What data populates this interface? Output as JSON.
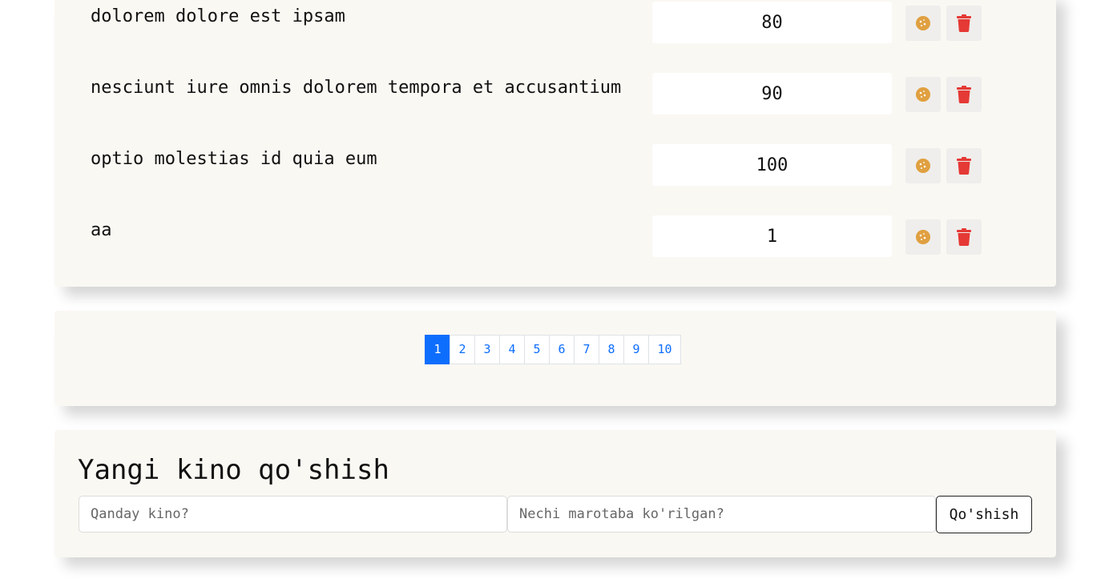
{
  "movies": [
    {
      "title": "dolorem dolore est ipsam",
      "count": "80"
    },
    {
      "title": "nesciunt iure omnis dolorem tempora et accusantium",
      "count": "90"
    },
    {
      "title": "optio molestias id quia eum",
      "count": "100"
    },
    {
      "title": "aa",
      "count": "1"
    }
  ],
  "pagination": {
    "pages": [
      "1",
      "2",
      "3",
      "4",
      "5",
      "6",
      "7",
      "8",
      "9",
      "10"
    ],
    "active_page": "1"
  },
  "form": {
    "title": "Yangi kino qo'shish",
    "name_placeholder": "Qanday kino?",
    "count_placeholder": "Nechi marotaba ko'rilgan?",
    "submit_label": "Qo'shish"
  },
  "colors": {
    "like_icon": "#e0a040",
    "delete_icon": "#e53935",
    "active_page": "#0d6efd"
  },
  "icons": {
    "like": "cookie-icon",
    "delete": "trash-icon"
  }
}
